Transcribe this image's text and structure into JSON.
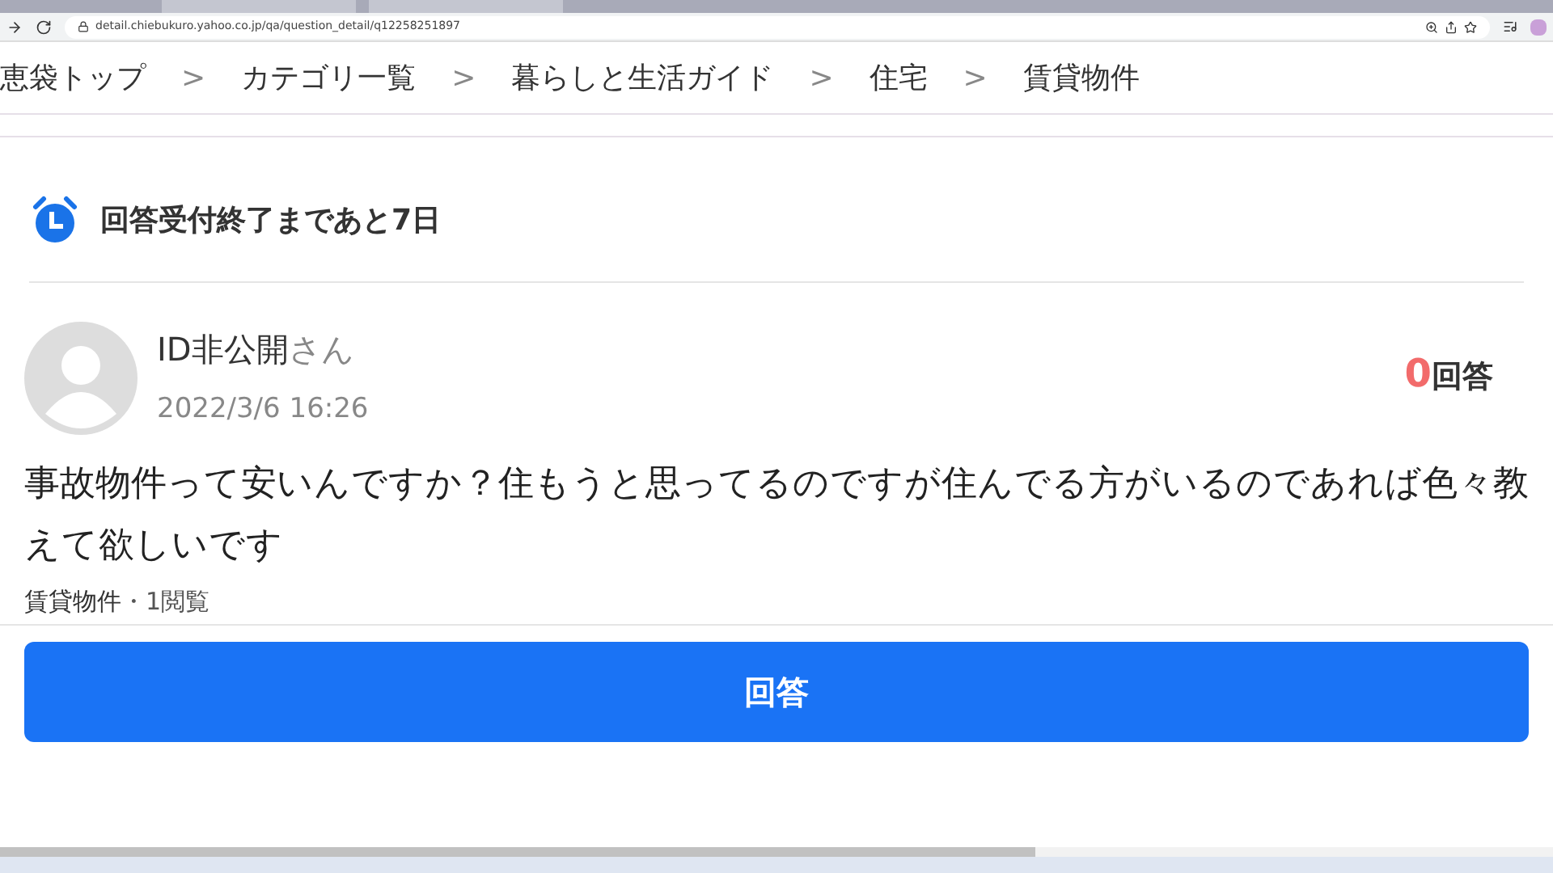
{
  "browser": {
    "url": "detail.chiebukuro.yahoo.co.jp/qa/question_detail/q12258251897"
  },
  "breadcrumbs": [
    "恵袋トップ",
    "カテゴリ一覧",
    "暮らしと生活ガイド",
    "住宅",
    "賃貸物件"
  ],
  "breadcrumb_separator": ">",
  "deadline": "回答受付終了まであと7日",
  "question": {
    "user": "ID非公開",
    "honorific": "さん",
    "date": "2022/3/6 16:26",
    "answer_count": "0",
    "answer_label": "回答",
    "text": "事故物件って安いんですか？住もうと思ってるのですが住んでる方がいるのであれば色々教えて欲しいです",
    "category": "賃貸物件",
    "views": "・1閲覧"
  },
  "answer_button": "回答"
}
